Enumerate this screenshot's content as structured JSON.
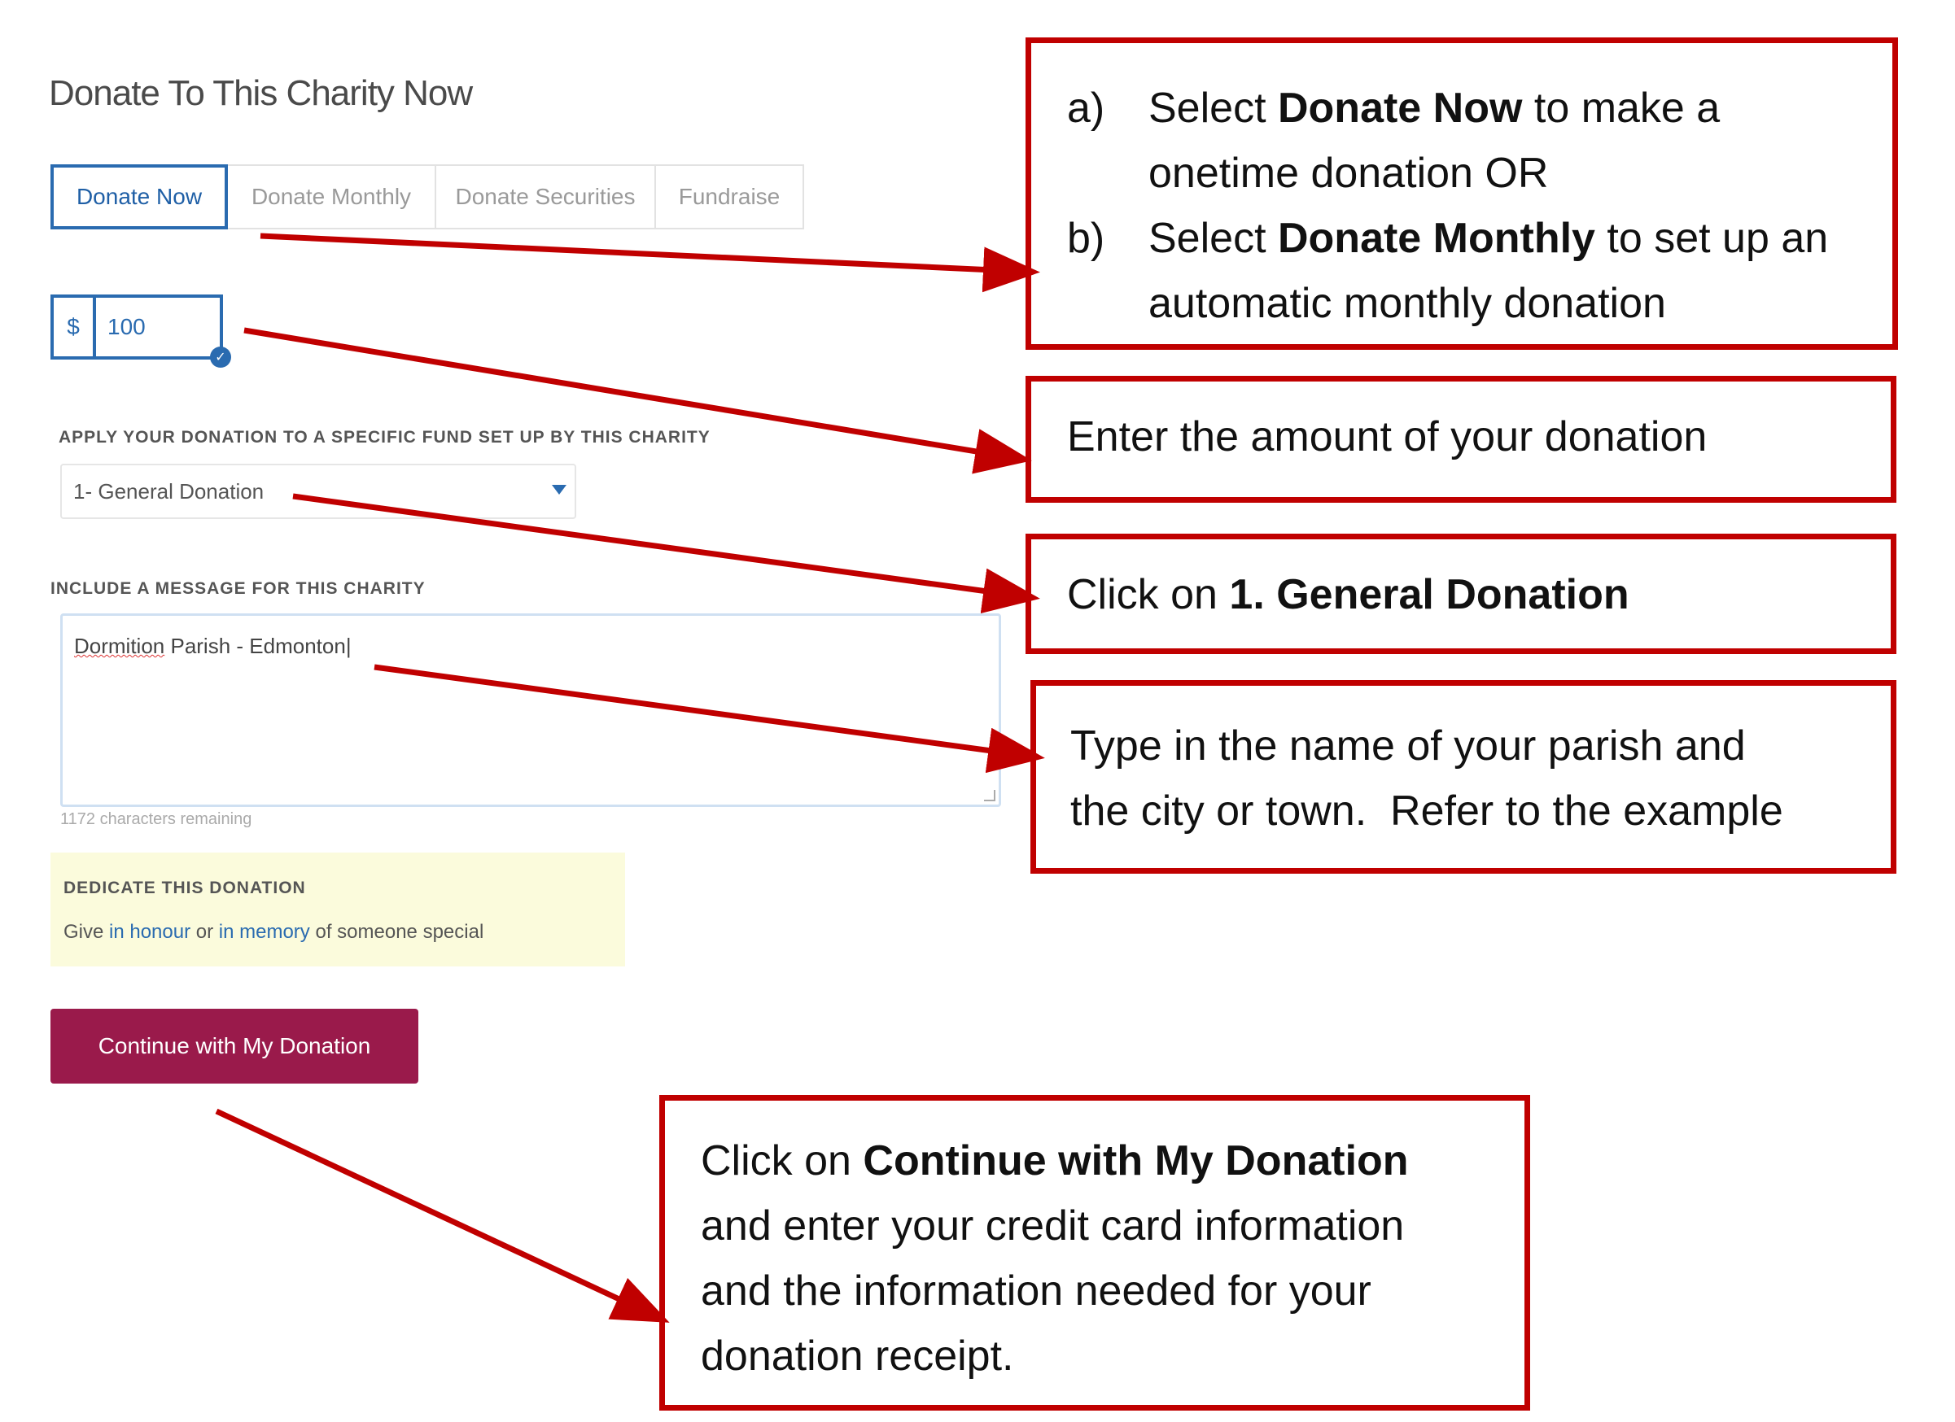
{
  "form": {
    "title": "Donate To This Charity Now",
    "tabs": [
      {
        "label": "Donate Now",
        "active": true
      },
      {
        "label": "Donate Monthly",
        "active": false
      },
      {
        "label": "Donate Securities",
        "active": false
      },
      {
        "label": "Fundraise",
        "active": false
      }
    ],
    "amount": {
      "currency_symbol": "$",
      "value": "100"
    },
    "fund": {
      "label": "APPLY YOUR DONATION TO A SPECIFIC FUND SET UP BY THIS CHARITY",
      "selected": "1- General Donation"
    },
    "message": {
      "label": "INCLUDE A MESSAGE FOR THIS CHARITY",
      "value_misspelled": "Dormition",
      "value_rest": " Parish  - Edmonton",
      "chars_remaining": "1172 characters remaining"
    },
    "dedicate": {
      "title": "DEDICATE THIS DONATION",
      "prefix": "Give ",
      "link_honour": "in honour",
      "middle": " or ",
      "link_memory": "in memory",
      "suffix": " of someone special"
    },
    "continue_label": "Continue with My Donation"
  },
  "callouts": {
    "c1": {
      "a_letter": "a)",
      "a_pre": "Select ",
      "a_bold": "Donate Now",
      "a_post": " to make a",
      "a_line2": "onetime donation OR",
      "b_letter": "b)",
      "b_pre": "Select ",
      "b_bold": "Donate Monthly",
      "b_post": " to set up an",
      "b_line2": "automatic monthly donation"
    },
    "c2": {
      "text": "Enter the amount of your donation"
    },
    "c3": {
      "pre": "Click on ",
      "bold": "1. General Donation"
    },
    "c4": {
      "line1": "Type in the name of your parish and",
      "line2": "the city or town.  Refer to the example"
    },
    "c5": {
      "pre": "Click on ",
      "bold": "Continue with My Donation",
      "line2": "and enter your credit card information",
      "line3": "and the information needed for your",
      "line4": "donation receipt."
    }
  },
  "colors": {
    "callout_border": "#c00000",
    "accent_blue": "#2a6bb0",
    "button": "#9a1a4b",
    "dedicate_bg": "#fbfbdc"
  },
  "icons": [
    "chevron-down-icon",
    "check-circle-icon",
    "resize-grip-icon",
    "arrow-icon"
  ]
}
